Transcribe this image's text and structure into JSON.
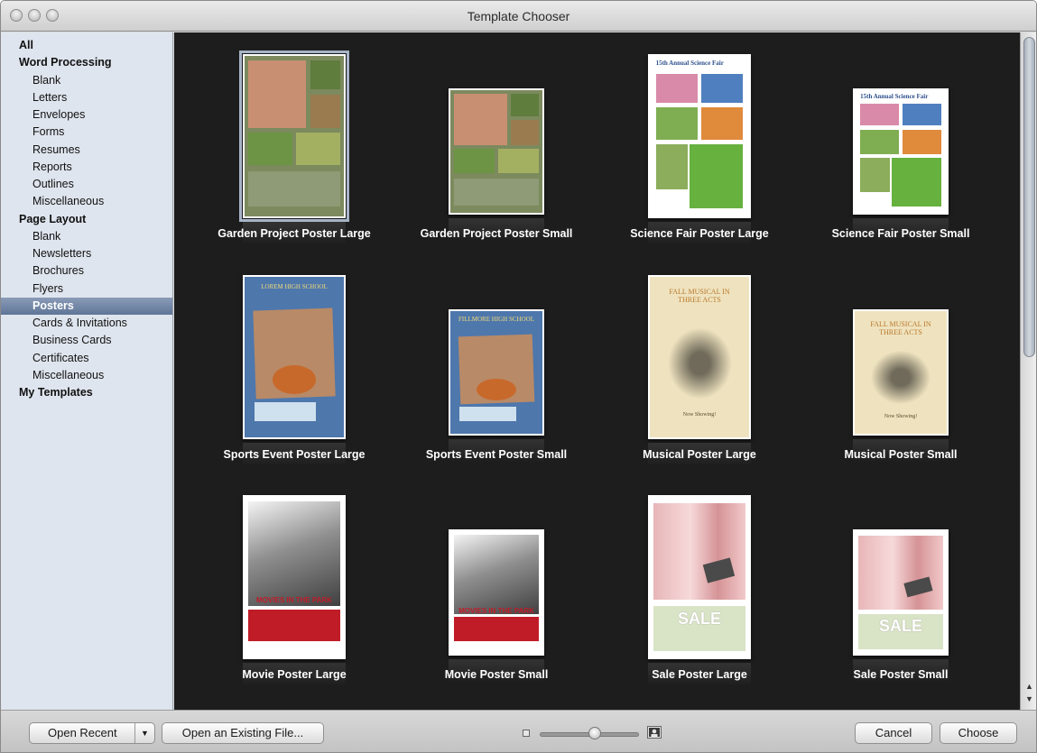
{
  "window": {
    "title": "Template Chooser"
  },
  "sidebar": {
    "items": [
      {
        "label": "All",
        "level": "head"
      },
      {
        "label": "Word Processing",
        "level": "head"
      },
      {
        "label": "Blank",
        "level": "sub"
      },
      {
        "label": "Letters",
        "level": "sub"
      },
      {
        "label": "Envelopes",
        "level": "sub"
      },
      {
        "label": "Forms",
        "level": "sub"
      },
      {
        "label": "Resumes",
        "level": "sub"
      },
      {
        "label": "Reports",
        "level": "sub"
      },
      {
        "label": "Outlines",
        "level": "sub"
      },
      {
        "label": "Miscellaneous",
        "level": "sub"
      },
      {
        "label": "Page Layout",
        "level": "head"
      },
      {
        "label": "Blank",
        "level": "sub"
      },
      {
        "label": "Newsletters",
        "level": "sub"
      },
      {
        "label": "Brochures",
        "level": "sub"
      },
      {
        "label": "Flyers",
        "level": "sub"
      },
      {
        "label": "Posters",
        "level": "sub",
        "selected": true
      },
      {
        "label": "Cards & Invitations",
        "level": "sub"
      },
      {
        "label": "Business Cards",
        "level": "sub"
      },
      {
        "label": "Certificates",
        "level": "sub"
      },
      {
        "label": "Miscellaneous",
        "level": "sub"
      },
      {
        "label": "My Templates",
        "level": "head"
      }
    ]
  },
  "gallery": {
    "templates": [
      {
        "label": "Garden Project Poster Large",
        "size": "large",
        "selected": true,
        "theme": "garden"
      },
      {
        "label": "Garden Project Poster Small",
        "size": "small",
        "theme": "garden"
      },
      {
        "label": "Science Fair Poster Large",
        "size": "large",
        "theme": "science",
        "text": {
          "heading": "15th Annual Science Fair"
        }
      },
      {
        "label": "Science Fair Poster Small",
        "size": "small",
        "theme": "science",
        "text": {
          "heading": "15th Annual Science Fair"
        }
      },
      {
        "label": "Sports Event Poster Large",
        "size": "large",
        "theme": "sports",
        "text": {
          "heading": "LOREM HIGH SCHOOL"
        }
      },
      {
        "label": "Sports Event Poster Small",
        "size": "small",
        "theme": "sports",
        "text": {
          "heading": "FILLMORE HIGH SCHOOL"
        }
      },
      {
        "label": "Musical Poster Large",
        "size": "large",
        "theme": "musical",
        "text": {
          "heading": "FALL MUSICAL IN THREE ACTS",
          "footer": "Now Showing!"
        }
      },
      {
        "label": "Musical Poster Small",
        "size": "small",
        "theme": "musical",
        "text": {
          "heading": "FALL MUSICAL IN THREE ACTS",
          "footer": "Now Showing!"
        }
      },
      {
        "label": "Movie Poster Large",
        "size": "large",
        "theme": "movie",
        "text": {
          "heading": "MOVIES IN THE PARK"
        }
      },
      {
        "label": "Movie Poster Small",
        "size": "small",
        "theme": "movie",
        "text": {
          "heading": "MOVIES IN THE PARK"
        }
      },
      {
        "label": "Sale Poster Large",
        "size": "large",
        "theme": "sale",
        "text": {
          "heading": "SALE"
        }
      },
      {
        "label": "Sale Poster Small",
        "size": "small",
        "theme": "sale",
        "text": {
          "heading": "SALE"
        }
      }
    ]
  },
  "footer": {
    "open_recent": "Open Recent",
    "open_existing": "Open an Existing File...",
    "cancel": "Cancel",
    "choose": "Choose",
    "zoom_level": 0.55
  }
}
